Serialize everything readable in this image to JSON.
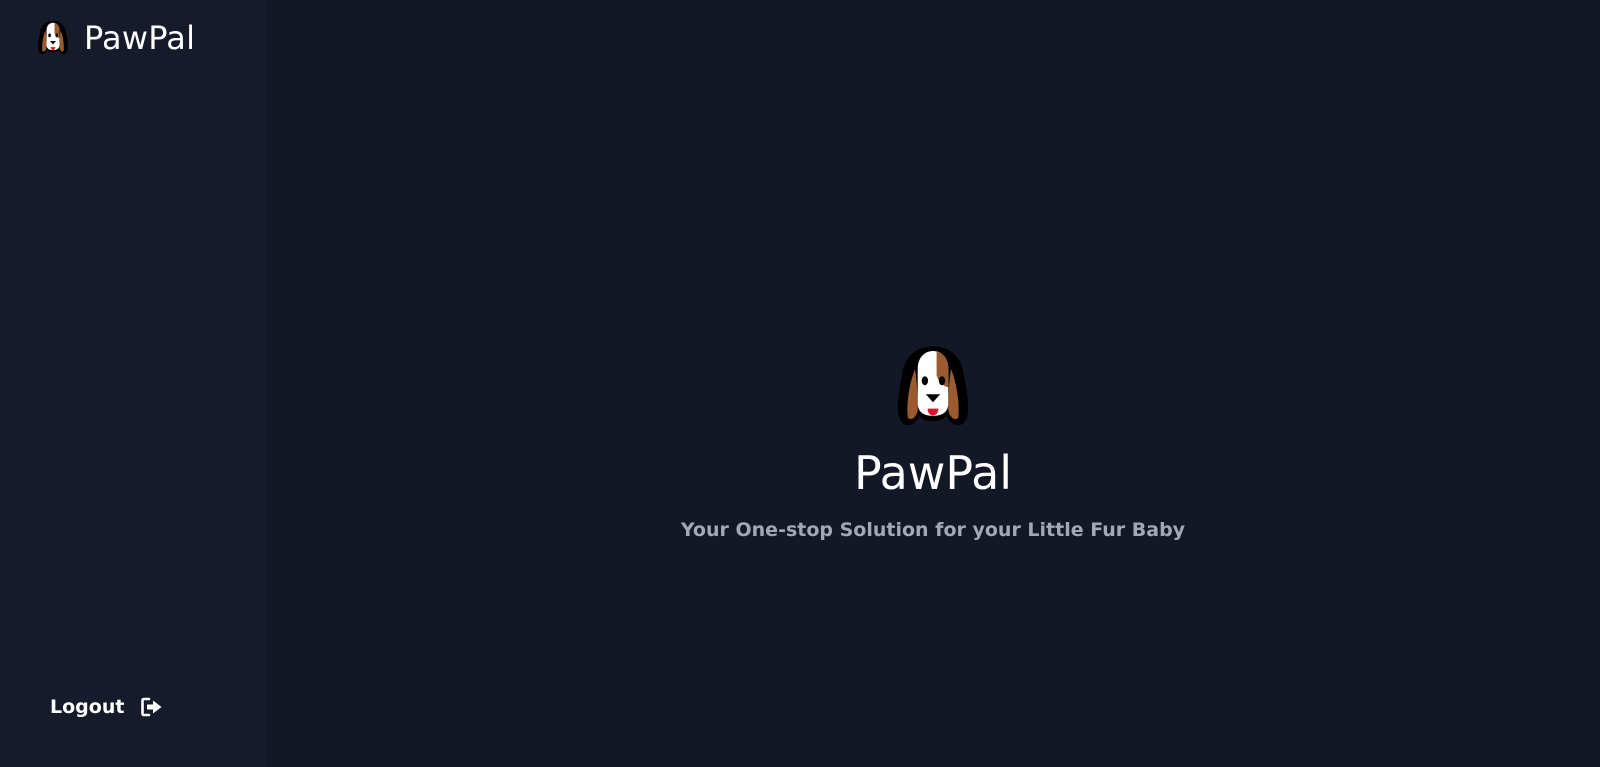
{
  "sidebar": {
    "brand": {
      "name": "PawPal",
      "icon": "dog-face-icon"
    },
    "logout": {
      "label": "Logout",
      "icon": "sign-out-icon"
    }
  },
  "main": {
    "hero": {
      "icon": "dog-face-icon",
      "title": "PawPal",
      "subtitle": "Your One-stop Solution for your Little Fur Baby"
    }
  },
  "colors": {
    "background": "#121826",
    "sidebar_background": "#151b2b",
    "text_primary": "#ffffff",
    "text_secondary": "#a2a9b5",
    "dog_brown": "#9b5b2e",
    "dog_tongue": "#e0112b"
  }
}
